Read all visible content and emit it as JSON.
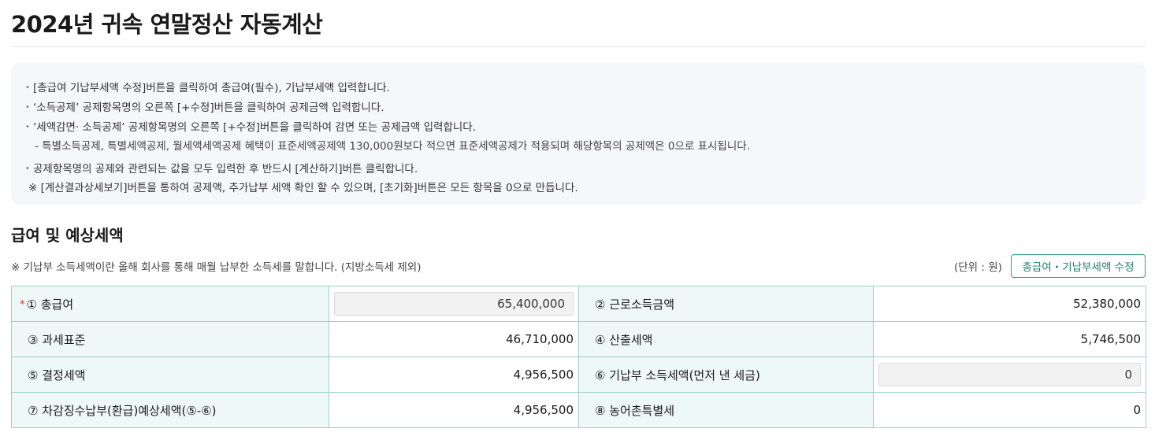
{
  "page": {
    "title": "2024년 귀속 연말정산 자동계산"
  },
  "notice": {
    "lines": [
      "[총급여 기납부세액 수정]버튼을 클릭하여 총급여(필수), 기납부세액 입력합니다.",
      "‘소득공제’ 공제항목명의 오른쪽 [+수정]버튼을 클릭하여 공제금액 입력합니다.",
      "‘세액감면· 소득공제’ 공제항목명의 오른쪽 [+수정]버튼을 클릭하여 감면 또는 공제금액 입력합니다.",
      "- 특별소득공제, 특별세액공제, 월세액세액공제 혜택이 표준세액공제액 130,000원보다 적으면 표준세액공제가 적용되며 해당항목의 공제액은 0으로 표시됩니다.",
      "공제항목명의 공제와 관련되는 값을 모두 입력한 후 반드시 [계산하기]버튼 클릭합니다.",
      "※ [계산결과상세보기]버튼을 통하여 공제액, 추가납부 세액 확인 할 수 있으며, [초기화]버튼은 모든 항목을 0으로 만듭니다."
    ]
  },
  "section": {
    "title": "급여 및 예상세액",
    "note": "※ 기납부 소득세액이란 올해 회사를 통해 매월 납부한 소득세를 말합니다. (지방소득세 제외)",
    "unit": "(단위 : 원)",
    "edit_button": "총급여・기납부세액 수정"
  },
  "table": {
    "required_mark": "*",
    "rows": [
      {
        "l1": "① 총급여",
        "v1": "65,400,000",
        "l2": "② 근로소득금액",
        "v2": "52,380,000"
      },
      {
        "l1": "③ 과세표준",
        "v1": "46,710,000",
        "l2": "④ 산출세액",
        "v2": "5,746,500"
      },
      {
        "l1": "⑤ 결정세액",
        "v1": "4,956,500",
        "l2": "⑥ 기납부 소득세액(먼저 낸 세금)",
        "v2": "0"
      },
      {
        "l1": "⑦ 차감징수납부(환급)예상세액(⑤-⑥)",
        "v1": "4,956,500",
        "l2": "⑧ 농어촌특별세",
        "v2": "0"
      }
    ]
  },
  "colors": {
    "accent": "#2f9d8a",
    "label_bg": "#eef8f6",
    "border": "#9fd0c8",
    "required": "#d9302c"
  }
}
